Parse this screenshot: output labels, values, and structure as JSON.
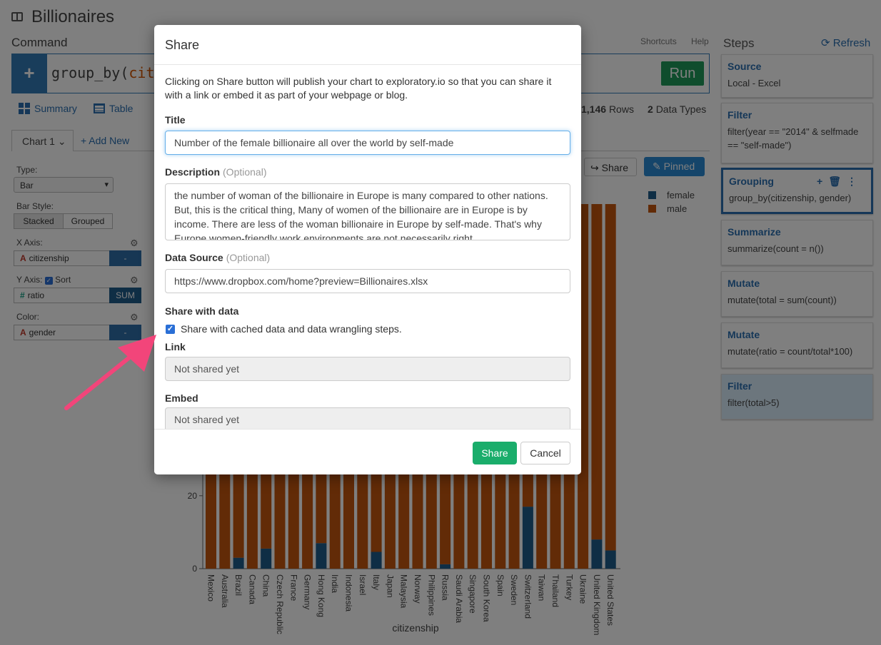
{
  "app": {
    "project_title": "Billionaires",
    "command_label": "Command",
    "command_code_prefix": "group_by(",
    "command_code_arg": "cit",
    "run_label": "Run",
    "shortcuts_label": "Shortcuts",
    "help_label": "Help",
    "steps_label": "Steps",
    "refresh_label": "Refresh",
    "tabs": {
      "summary": "Summary",
      "table": "Table"
    },
    "rows_count": "1,146",
    "rows_label": "Rows",
    "types_count": "2",
    "types_label": "Data Types",
    "chart_tab": "Chart 1",
    "add_new": "+ Add New",
    "share_btn": "Share",
    "pinned_btn": "Pinned"
  },
  "config": {
    "type_label": "Type:",
    "type_value": "Bar",
    "bar_style_label": "Bar Style:",
    "stacked": "Stacked",
    "grouped": "Grouped",
    "x_axis_label": "X Axis:",
    "x_axis_value": "citizenship",
    "x_axis_agg": "-",
    "y_axis_label": "Y Axis:",
    "sort_label": "Sort",
    "y_axis_value": "ratio",
    "y_axis_agg": "SUM",
    "color_label": "Color:",
    "color_value": "gender",
    "color_agg": "-"
  },
  "steps": [
    {
      "title": "Source",
      "desc": "Local - Excel"
    },
    {
      "title": "Filter",
      "desc": "filter(year == \"2014\" & selfmade == \"self-made\")"
    },
    {
      "title": "Grouping",
      "desc": "group_by(citizenship, gender)"
    },
    {
      "title": "Summarize",
      "desc": "summarize(count = n())"
    },
    {
      "title": "Mutate",
      "desc": "mutate(total = sum(count))"
    },
    {
      "title": "Mutate",
      "desc": "mutate(ratio = count/total*100)"
    },
    {
      "title": "Filter",
      "desc": "filter(total>5)"
    }
  ],
  "chart_data": {
    "type": "bar",
    "stacked": true,
    "xlabel": "citizenship",
    "ylabel": "",
    "ylim": [
      0,
      100
    ],
    "y_ticks": [
      "0",
      "20"
    ],
    "categories": [
      "Mexico",
      "Australia",
      "Brazil",
      "Canada",
      "China",
      "Czech Republic",
      "France",
      "Germany",
      "Hong Kong",
      "India",
      "Indonesia",
      "Israel",
      "Italy",
      "Japan",
      "Malaysia",
      "Norway",
      "Philippines",
      "Russia",
      "Saudi Arabia",
      "Singapore",
      "South Korea",
      "Spain",
      "Sweden",
      "Switzerland",
      "Taiwan",
      "Thailand",
      "Turkey",
      "Ukraine",
      "United Kingdom",
      "United States"
    ],
    "series": [
      {
        "name": "female",
        "color": "#1f5c8b",
        "values": [
          0,
          0,
          3,
          0,
          5.5,
          0,
          0,
          0,
          7,
          0,
          0,
          0,
          4.6,
          0,
          0,
          0,
          0,
          1.2,
          0,
          0,
          0,
          0,
          0,
          17,
          0,
          0,
          0,
          0,
          8,
          5
        ]
      },
      {
        "name": "male",
        "color": "#c5560f",
        "values": [
          100,
          100,
          97,
          100,
          94.5,
          100,
          100,
          100,
          93,
          100,
          100,
          100,
          95.4,
          100,
          100,
          100,
          100,
          98.8,
          100,
          100,
          100,
          100,
          100,
          83,
          100,
          100,
          100,
          100,
          92,
          95
        ]
      }
    ],
    "legend": "top-right"
  },
  "modal": {
    "title": "Share",
    "intro": "Clicking on Share button will publish your chart to exploratory.io so that you can share it with a link or embed it as part of your webpage or blog.",
    "title_label": "Title",
    "title_value": "Number of the female billionaire all over the world by self-made",
    "description_label": "Description",
    "optional": "(Optional)",
    "description_value": "the number of woman of the billionaire in Europe is many compared to other nations. But, this is the critical thing, Many of women of the billionaire are in Europe is by income. There are less of the woman billionaire in Europe by self-made. That's why Europe women-friendly work environments are not necessarily right.",
    "data_source_label": "Data Source",
    "data_source_value": "https://www.dropbox.com/home?preview=Billionaires.xlsx",
    "share_with_data_label": "Share with data",
    "share_with_data_check": "Share with cached data and data wrangling steps.",
    "link_label": "Link",
    "link_value": "Not shared yet",
    "embed_label": "Embed",
    "embed_value": "Not shared yet",
    "share_button": "Share",
    "cancel_button": "Cancel"
  },
  "colors": {
    "accent": "#2a6fb0",
    "run": "#1e9b5a",
    "share": "#1aad6b",
    "arrow": "#f2457a"
  }
}
